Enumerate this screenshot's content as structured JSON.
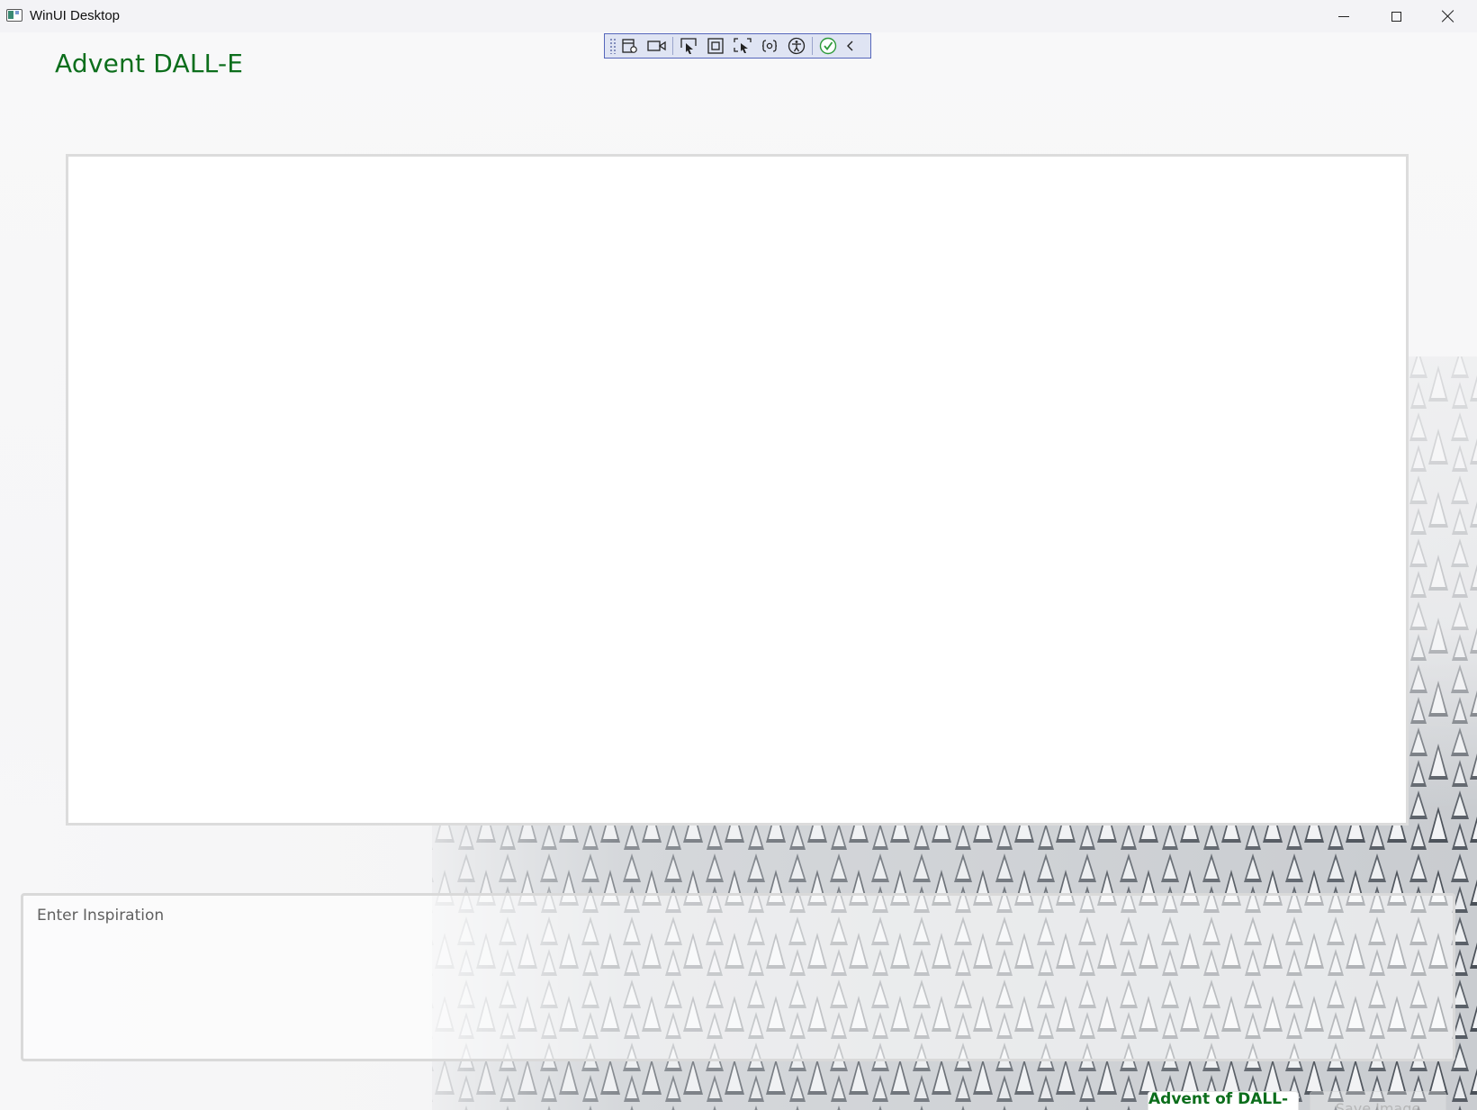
{
  "window": {
    "title": "WinUI Desktop",
    "controls": {
      "minimize": "minimize-icon",
      "maximize": "maximize-icon",
      "close": "close-icon"
    }
  },
  "dev_toolbar": {
    "buttons": [
      {
        "icon": "app-toolbar-icon"
      },
      {
        "icon": "video-camera-icon"
      },
      {
        "icon": "select-element-icon"
      },
      {
        "icon": "display-layout-adorners-icon"
      },
      {
        "icon": "track-focused-element-icon"
      },
      {
        "icon": "binding-failures-icon"
      },
      {
        "icon": "accessibility-checker-icon"
      },
      {
        "icon": "hot-reload-status-icon"
      },
      {
        "icon": "collapse-chevron-icon"
      }
    ]
  },
  "header": {
    "title": "Advent DALL-E"
  },
  "prompt": {
    "placeholder": "Enter Inspiration",
    "value": ""
  },
  "actions": {
    "generate_label": "Advent of DALL-E",
    "save_label": "Save Image"
  },
  "colors": {
    "accent_green": "#0c6e1c",
    "frame_border": "#dcdcdc"
  }
}
